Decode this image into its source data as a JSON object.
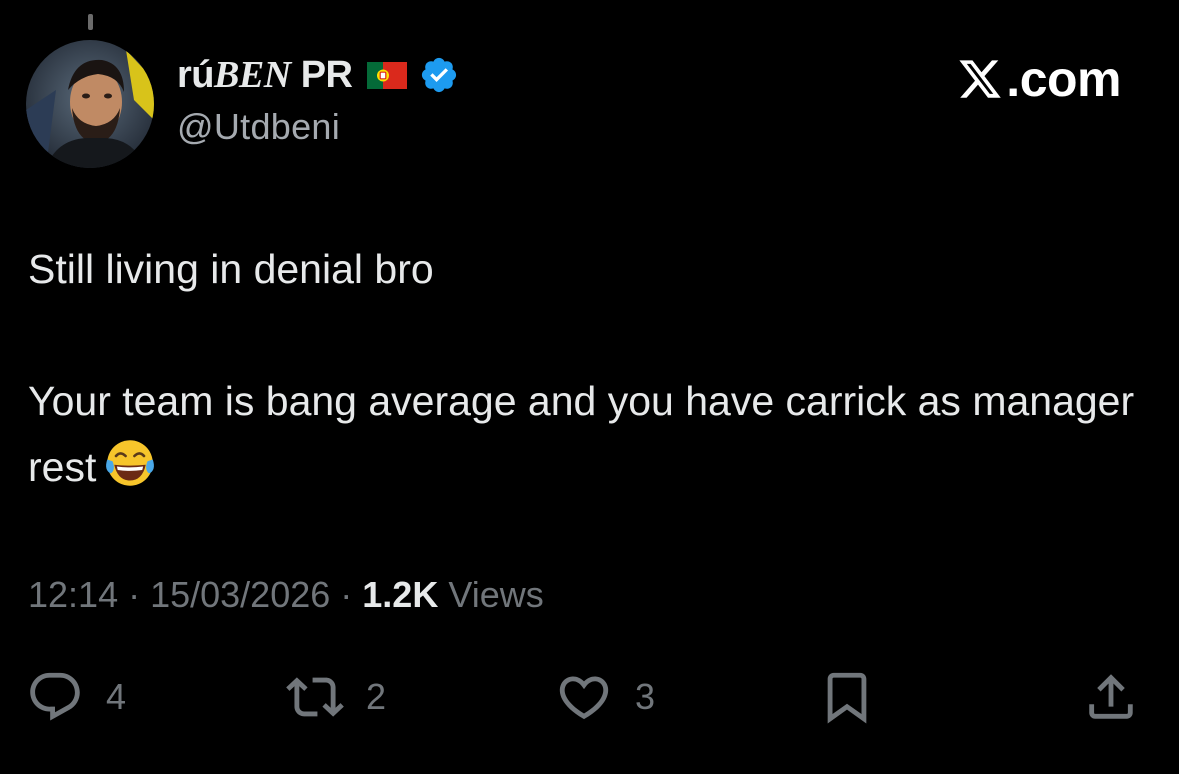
{
  "author": {
    "name_prefix": "rú",
    "name_italic": "BEN",
    "name_suffix": " PR",
    "handle": "@Utdbeni"
  },
  "brand": {
    "label": ".com"
  },
  "tweet": {
    "text": "Still living in denial bro\n\nYour team is bang average and you have carrick as manager rest"
  },
  "meta": {
    "time": "12:14",
    "separator": " · ",
    "date": "15/03/2026",
    "views_count": "1.2K",
    "views_label": " Views"
  },
  "actions": {
    "replies": "4",
    "reposts": "2",
    "likes": "3"
  },
  "colors": {
    "background": "#000000",
    "text": "#e7e9ea",
    "secondary": "#71767b",
    "verified": "#1d9bf0"
  },
  "icons": [
    "verified-badge-icon",
    "portugal-flag-icon",
    "x-logo-icon",
    "tears-of-joy-emoji",
    "reply-icon",
    "repost-icon",
    "like-icon",
    "bookmark-icon",
    "share-icon"
  ]
}
